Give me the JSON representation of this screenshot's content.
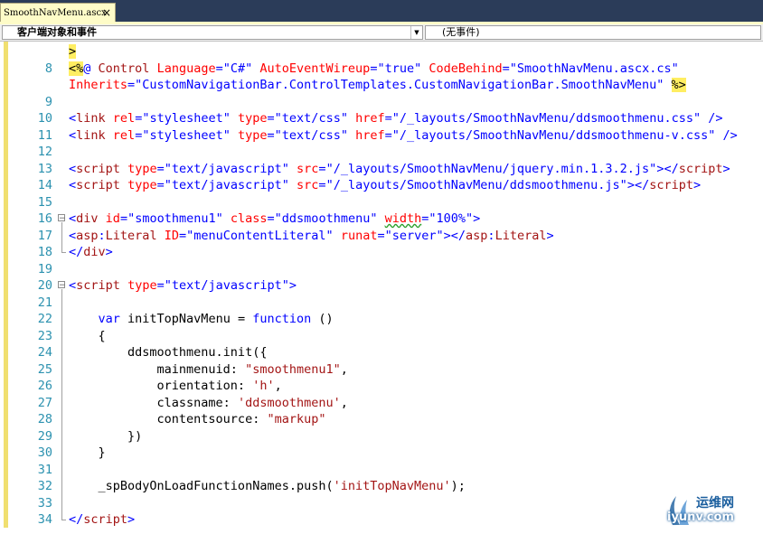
{
  "tab": {
    "filename": "SmoothNavMenu.ascx",
    "close_glyph": "×"
  },
  "dropdowns": {
    "left_value": "客户端对象和事件",
    "right_value": "(无事件)"
  },
  "colors": {
    "line_numbers": "#2b91af",
    "keyword": "#0000ff",
    "string": "#a31515",
    "attribute": "#ff0000",
    "highlight": "#ffee62",
    "tab_background": "#fefcc8",
    "title_strip": "#2b3c59"
  },
  "watermark": {
    "site_cn": "运维网",
    "site_url": "iyunv.com"
  },
  "code_lines": [
    {
      "num": "",
      "tokens": [
        {
          "c": "hl",
          "t": ">"
        }
      ]
    },
    {
      "num": "8",
      "tokens": [
        {
          "c": "hl",
          "t": "<%"
        },
        {
          "c": "b",
          "t": "@ "
        },
        {
          "c": "m",
          "t": "Control "
        },
        {
          "c": "r",
          "t": "Language"
        },
        {
          "c": "b",
          "t": "="
        },
        {
          "c": "b",
          "t": "\"C#\""
        },
        {
          "c": "p",
          "t": " "
        },
        {
          "c": "r",
          "t": "AutoEventWireup"
        },
        {
          "c": "b",
          "t": "="
        },
        {
          "c": "b",
          "t": "\"true\""
        },
        {
          "c": "p",
          "t": " "
        },
        {
          "c": "r",
          "t": "CodeBehind"
        },
        {
          "c": "b",
          "t": "="
        },
        {
          "c": "b",
          "t": "\"SmoothNavMenu.ascx.cs\""
        }
      ]
    },
    {
      "num": "",
      "tokens": [
        {
          "c": "r",
          "t": "Inherits"
        },
        {
          "c": "b",
          "t": "="
        },
        {
          "c": "b",
          "t": "\"CustomNavigationBar.ControlTemplates.CustomNavigationBar.SmoothNavMenu\""
        },
        {
          "c": "p",
          "t": " "
        },
        {
          "c": "hl",
          "t": "%>"
        }
      ]
    },
    {
      "num": "9",
      "tokens": []
    },
    {
      "num": "10",
      "tokens": [
        {
          "c": "b",
          "t": "<"
        },
        {
          "c": "m",
          "t": "link"
        },
        {
          "c": "p",
          "t": " "
        },
        {
          "c": "r",
          "t": "rel"
        },
        {
          "c": "b",
          "t": "="
        },
        {
          "c": "b",
          "t": "\"stylesheet\""
        },
        {
          "c": "p",
          "t": " "
        },
        {
          "c": "r",
          "t": "type"
        },
        {
          "c": "b",
          "t": "="
        },
        {
          "c": "b",
          "t": "\"text/css\""
        },
        {
          "c": "p",
          "t": " "
        },
        {
          "c": "r",
          "t": "href"
        },
        {
          "c": "b",
          "t": "="
        },
        {
          "c": "b",
          "t": "\"/_layouts/SmoothNavMenu/ddsmoothmenu.css\""
        },
        {
          "c": "p",
          "t": " "
        },
        {
          "c": "b",
          "t": "/>"
        }
      ]
    },
    {
      "num": "11",
      "tokens": [
        {
          "c": "b",
          "t": "<"
        },
        {
          "c": "m",
          "t": "link"
        },
        {
          "c": "p",
          "t": " "
        },
        {
          "c": "r",
          "t": "rel"
        },
        {
          "c": "b",
          "t": "="
        },
        {
          "c": "b",
          "t": "\"stylesheet\""
        },
        {
          "c": "p",
          "t": " "
        },
        {
          "c": "r",
          "t": "type"
        },
        {
          "c": "b",
          "t": "="
        },
        {
          "c": "b",
          "t": "\"text/css\""
        },
        {
          "c": "p",
          "t": " "
        },
        {
          "c": "r",
          "t": "href"
        },
        {
          "c": "b",
          "t": "="
        },
        {
          "c": "b",
          "t": "\"/_layouts/SmoothNavMenu/ddsmoothmenu-v.css\""
        },
        {
          "c": "p",
          "t": " "
        },
        {
          "c": "b",
          "t": "/>"
        }
      ]
    },
    {
      "num": "12",
      "tokens": []
    },
    {
      "num": "13",
      "tokens": [
        {
          "c": "b",
          "t": "<"
        },
        {
          "c": "m",
          "t": "script"
        },
        {
          "c": "p",
          "t": " "
        },
        {
          "c": "r",
          "t": "type"
        },
        {
          "c": "b",
          "t": "="
        },
        {
          "c": "b",
          "t": "\"text/javascript\""
        },
        {
          "c": "p",
          "t": " "
        },
        {
          "c": "r",
          "t": "src"
        },
        {
          "c": "b",
          "t": "="
        },
        {
          "c": "b",
          "t": "\"/_layouts/SmoothNavMenu/jquery.min.1.3.2.js\""
        },
        {
          "c": "b",
          "t": "></"
        },
        {
          "c": "m",
          "t": "script"
        },
        {
          "c": "b",
          "t": ">"
        }
      ]
    },
    {
      "num": "14",
      "tokens": [
        {
          "c": "b",
          "t": "<"
        },
        {
          "c": "m",
          "t": "script"
        },
        {
          "c": "p",
          "t": " "
        },
        {
          "c": "r",
          "t": "type"
        },
        {
          "c": "b",
          "t": "="
        },
        {
          "c": "b",
          "t": "\"text/javascript\""
        },
        {
          "c": "p",
          "t": " "
        },
        {
          "c": "r",
          "t": "src"
        },
        {
          "c": "b",
          "t": "="
        },
        {
          "c": "b",
          "t": "\"/_layouts/SmoothNavMenu/ddsmoothmenu.js\""
        },
        {
          "c": "b",
          "t": "></"
        },
        {
          "c": "m",
          "t": "script"
        },
        {
          "c": "b",
          "t": ">"
        }
      ]
    },
    {
      "num": "15",
      "tokens": []
    },
    {
      "num": "16",
      "collapse": true,
      "tokens": [
        {
          "c": "b",
          "t": "<"
        },
        {
          "c": "m",
          "t": "div"
        },
        {
          "c": "p",
          "t": " "
        },
        {
          "c": "r",
          "t": "id"
        },
        {
          "c": "b",
          "t": "="
        },
        {
          "c": "b",
          "t": "\"smoothmenu1\""
        },
        {
          "c": "p",
          "t": " "
        },
        {
          "c": "r",
          "t": "class"
        },
        {
          "c": "b",
          "t": "="
        },
        {
          "c": "b",
          "t": "\"ddsmoothmenu\""
        },
        {
          "c": "p",
          "t": " "
        },
        {
          "c": "r squig",
          "t": "width"
        },
        {
          "c": "b",
          "t": "="
        },
        {
          "c": "b",
          "t": "\"100%\""
        },
        {
          "c": "b",
          "t": ">"
        }
      ]
    },
    {
      "num": "17",
      "tokens": [
        {
          "c": "b",
          "t": "<"
        },
        {
          "c": "m",
          "t": "asp"
        },
        {
          "c": "b",
          "t": ":"
        },
        {
          "c": "m",
          "t": "Literal"
        },
        {
          "c": "p",
          "t": " "
        },
        {
          "c": "r",
          "t": "ID"
        },
        {
          "c": "b",
          "t": "="
        },
        {
          "c": "b",
          "t": "\"menuContentLiteral\""
        },
        {
          "c": "p",
          "t": " "
        },
        {
          "c": "r",
          "t": "runat"
        },
        {
          "c": "b",
          "t": "="
        },
        {
          "c": "b",
          "t": "\"server\""
        },
        {
          "c": "b",
          "t": "></"
        },
        {
          "c": "m",
          "t": "asp"
        },
        {
          "c": "b",
          "t": ":"
        },
        {
          "c": "m",
          "t": "Literal"
        },
        {
          "c": "b",
          "t": ">"
        }
      ]
    },
    {
      "num": "18",
      "tokens": [
        {
          "c": "b",
          "t": "</"
        },
        {
          "c": "m",
          "t": "div"
        },
        {
          "c": "b",
          "t": ">"
        }
      ]
    },
    {
      "num": "19",
      "tokens": []
    },
    {
      "num": "20",
      "collapse": true,
      "tokens": [
        {
          "c": "b",
          "t": "<"
        },
        {
          "c": "m",
          "t": "script"
        },
        {
          "c": "p",
          "t": " "
        },
        {
          "c": "r",
          "t": "type"
        },
        {
          "c": "b",
          "t": "="
        },
        {
          "c": "b",
          "t": "\"text/javascript\""
        },
        {
          "c": "b",
          "t": ">"
        }
      ]
    },
    {
      "num": "21",
      "tokens": []
    },
    {
      "num": "22",
      "tokens": [
        {
          "c": "p",
          "t": "    "
        },
        {
          "c": "k",
          "t": "var"
        },
        {
          "c": "p",
          "t": " initTopNavMenu = "
        },
        {
          "c": "k",
          "t": "function"
        },
        {
          "c": "p",
          "t": " ()"
        }
      ]
    },
    {
      "num": "23",
      "tokens": [
        {
          "c": "p",
          "t": "    {"
        }
      ]
    },
    {
      "num": "24",
      "tokens": [
        {
          "c": "p",
          "t": "        ddsmoothmenu.init({"
        }
      ]
    },
    {
      "num": "25",
      "tokens": [
        {
          "c": "p",
          "t": "            mainmenuid: "
        },
        {
          "c": "s",
          "t": "\"smoothmenu1\""
        },
        {
          "c": "p",
          "t": ","
        }
      ]
    },
    {
      "num": "26",
      "tokens": [
        {
          "c": "p",
          "t": "            orientation: "
        },
        {
          "c": "s",
          "t": "'h'"
        },
        {
          "c": "p",
          "t": ","
        }
      ]
    },
    {
      "num": "27",
      "tokens": [
        {
          "c": "p",
          "t": "            classname: "
        },
        {
          "c": "s",
          "t": "'ddsmoothmenu'"
        },
        {
          "c": "p",
          "t": ","
        }
      ]
    },
    {
      "num": "28",
      "tokens": [
        {
          "c": "p",
          "t": "            contentsource: "
        },
        {
          "c": "s",
          "t": "\"markup\""
        }
      ]
    },
    {
      "num": "29",
      "tokens": [
        {
          "c": "p",
          "t": "        })"
        }
      ]
    },
    {
      "num": "30",
      "tokens": [
        {
          "c": "p",
          "t": "    }"
        }
      ]
    },
    {
      "num": "31",
      "tokens": []
    },
    {
      "num": "32",
      "tokens": [
        {
          "c": "p",
          "t": "    _spBodyOnLoadFunctionNames.push("
        },
        {
          "c": "s",
          "t": "'initTopNavMenu'"
        },
        {
          "c": "p",
          "t": ");"
        }
      ]
    },
    {
      "num": "33",
      "tokens": []
    },
    {
      "num": "34",
      "tokens": [
        {
          "c": "b",
          "t": "</"
        },
        {
          "c": "m",
          "t": "script"
        },
        {
          "c": "b",
          "t": ">"
        }
      ]
    }
  ]
}
